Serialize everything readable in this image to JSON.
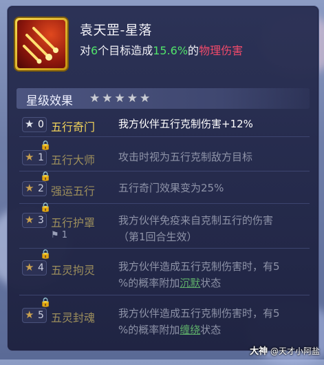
{
  "skill": {
    "name": "袁天罡-星落",
    "desc_prefix": "对",
    "target_count": "6",
    "desc_mid": "个目标造成",
    "damage_pct": "15.6%",
    "desc_of": "的",
    "damage_type": "物理伤害"
  },
  "section": {
    "title": "星级效果",
    "stars": 5
  },
  "levels": [
    {
      "num": "0",
      "title": "五行奇门",
      "lines": [
        "我方伙伴五行克制伤害+12%"
      ],
      "locked": false,
      "active": true
    },
    {
      "num": "1",
      "title": "五行大师",
      "lines": [
        "攻击时视为五行克制敌方目标"
      ],
      "locked": true,
      "active": false
    },
    {
      "num": "2",
      "title": "强运五行",
      "lines": [
        "五行奇门效果变为25%"
      ],
      "locked": true,
      "active": false
    },
    {
      "num": "3",
      "title": "五行护罩",
      "lines": [
        "我方伙伴免疫来自克制五行的伤害",
        "（第1回合生效）"
      ],
      "locked": true,
      "active": false,
      "flag_count": "1"
    },
    {
      "num": "4",
      "title": "五灵拘灵",
      "line1": "我方伙伴造成五行克制伤害时，有5",
      "line2_prefix": "%的概率附加",
      "keyword": "沉默",
      "line2_suffix": "状态",
      "locked": true,
      "active": false
    },
    {
      "num": "5",
      "title": "五灵封魂",
      "line1": "我方伙伴造成五行克制伤害时，有5",
      "line2_prefix": "%的概率附加",
      "keyword": "缠绕",
      "line2_suffix": "状态",
      "locked": true,
      "active": false
    }
  ],
  "watermark": {
    "brand": "大神",
    "user": "@天才小阿盐"
  },
  "colors": {
    "panel_bg": "#262b4f",
    "highlight_green": "#51e36a",
    "damage_red": "#f04a6a",
    "active_title": "#f2d35a",
    "locked_title": "#9b8d5c"
  }
}
